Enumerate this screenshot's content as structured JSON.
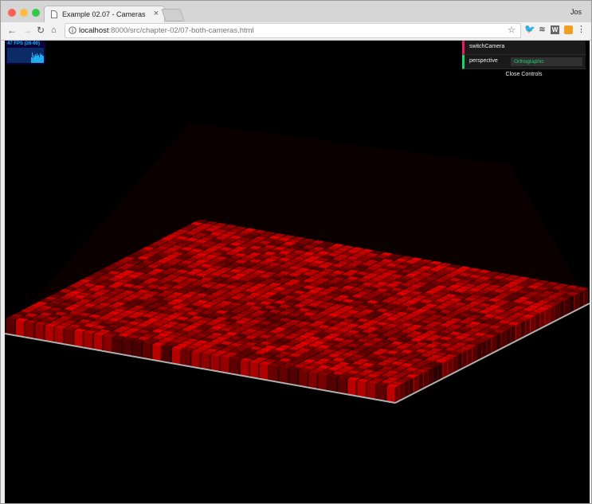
{
  "browser": {
    "tab_title": "Example 02.07 - Cameras",
    "tab_close": "×",
    "profile_name": "Jos",
    "url_host": "localhost",
    "url_path": ":8000/src/chapter-02/07-both-cameras.html"
  },
  "page": {
    "stats": {
      "fps_text": "47 FPS (26-60)"
    },
    "gui": {
      "switch_label": "switchCamera",
      "perspective_label": "perspective",
      "perspective_value": "Orthographic",
      "close_label": "Close Controls"
    },
    "scene": {
      "cube_color": "#c00000",
      "floor_color": "#b0b0b0",
      "background": "#000000"
    }
  }
}
